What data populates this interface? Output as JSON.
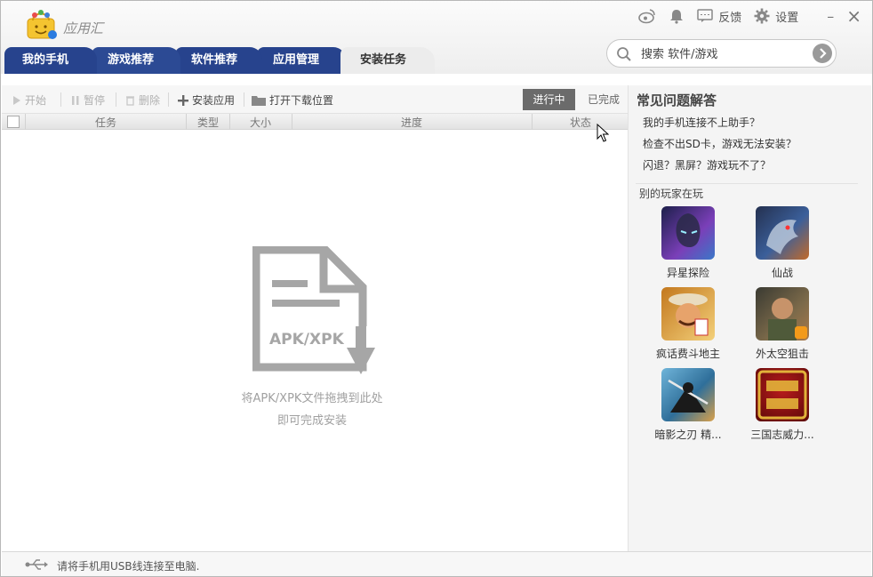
{
  "app": {
    "title": "应用汇"
  },
  "topbar": {
    "weibo_icon": "weibo-icon",
    "bell_icon": "bell-icon",
    "feedback_label": "反馈",
    "settings_label": "设置",
    "minimize": "–",
    "close": "×"
  },
  "tabs": [
    {
      "label": "我的手机"
    },
    {
      "label": "游戏推荐"
    },
    {
      "label": "软件推荐"
    },
    {
      "label": "应用管理"
    },
    {
      "label": "安装任务",
      "active": true
    }
  ],
  "search": {
    "placeholder": "搜索 软件/游戏"
  },
  "toolbar": {
    "start": "开始",
    "pause": "暂停",
    "delete": "删除",
    "install_app": "安装应用",
    "open_download": "打开下载位置",
    "in_progress": "进行中",
    "completed": "已完成"
  },
  "table": {
    "columns": [
      "任务",
      "类型",
      "大小",
      "进度",
      "状态"
    ]
  },
  "empty": {
    "art_label": "APK/XPK",
    "hint_line1": "将APK/XPK文件拖拽到此处",
    "hint_line2": "即可完成安装"
  },
  "sidebar": {
    "faq_title": "常见问题解答",
    "faq": [
      "我的手机连接不上助手？",
      "检查不出SD卡，游戏无法安装？",
      "闪退？黑屏？游戏玩不了？"
    ],
    "others_title": "别的玩家在玩",
    "games": [
      {
        "name": "异星探险",
        "colors": [
          "#1c1f4a",
          "#7a3fb8"
        ]
      },
      {
        "name": "仙战",
        "colors": [
          "#24304f",
          "#c26a2a"
        ]
      },
      {
        "name": "疯话费斗地主",
        "colors": [
          "#c3781e",
          "#f3d07a"
        ]
      },
      {
        "name": "外太空狙击",
        "colors": [
          "#3a3a32",
          "#a8794a"
        ]
      },
      {
        "name": "暗影之刃 精...",
        "colors": [
          "#2f6f9a",
          "#d9a04a"
        ]
      },
      {
        "name": "三国志威力...",
        "colors": [
          "#7a1010",
          "#e2b23a"
        ]
      }
    ]
  },
  "status": {
    "text": "请将手机用USB线连接至电脑."
  },
  "colors": {
    "tab_blue": "#27438d",
    "active_seg": "#6b6b6b"
  }
}
